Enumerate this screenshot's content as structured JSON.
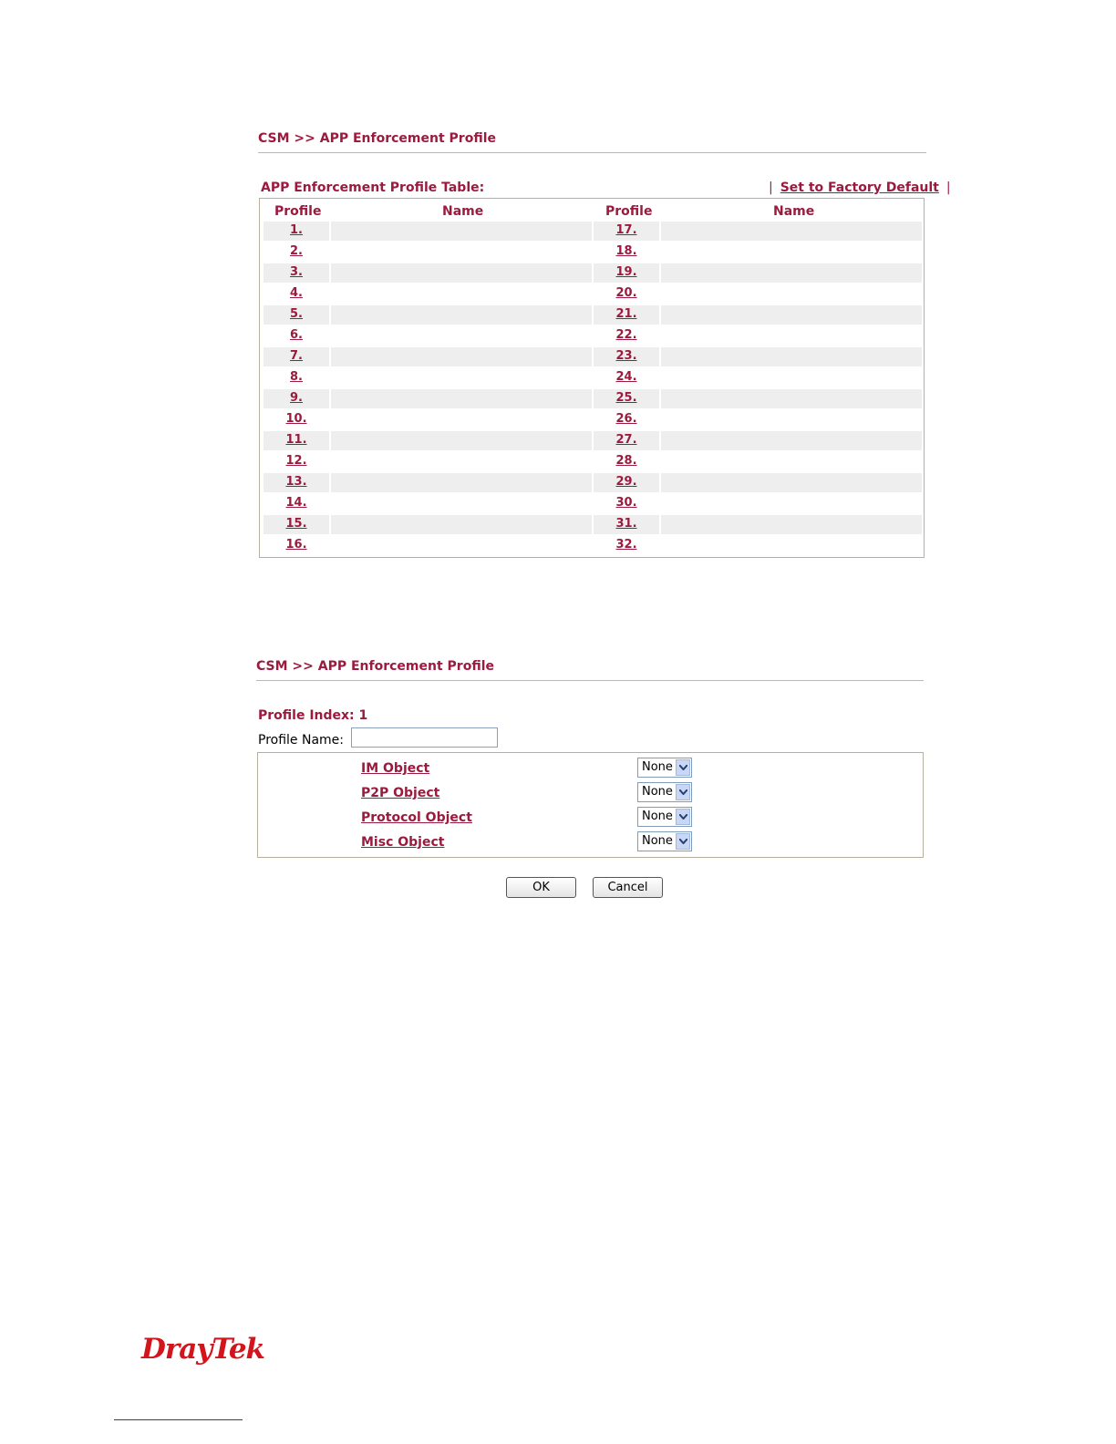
{
  "panel1": {
    "breadcrumb": "CSM >> APP Enforcement Profile",
    "table_title": "APP Enforcement Profile Table:",
    "separator": "|",
    "factory_default": "Set to Factory Default",
    "columns": {
      "profile": "Profile",
      "name": "Name"
    },
    "left_profiles": [
      "1.",
      "2.",
      "3.",
      "4.",
      "5.",
      "6.",
      "7.",
      "8.",
      "9.",
      "10.",
      "11.",
      "12.",
      "13.",
      "14.",
      "15.",
      "16."
    ],
    "right_profiles": [
      "17.",
      "18.",
      "19.",
      "20.",
      "21.",
      "22.",
      "23.",
      "24.",
      "25.",
      "26.",
      "27.",
      "28.",
      "29.",
      "30.",
      "31.",
      "32."
    ]
  },
  "panel2": {
    "breadcrumb": "CSM >> APP Enforcement Profile",
    "profile_index": "Profile Index: 1",
    "profile_name_label": "Profile Name:",
    "profile_name_value": "",
    "objects": [
      {
        "label": "IM Object",
        "value": "None"
      },
      {
        "label": "P2P Object",
        "value": "None"
      },
      {
        "label": "Protocol Object",
        "value": "None"
      },
      {
        "label": "Misc Object",
        "value": "None"
      }
    ],
    "ok_label": "OK",
    "cancel_label": "Cancel"
  },
  "logo": "DrayTek",
  "colors": {
    "accent": "#9b1b3f",
    "row_shade": "#eeeeee",
    "logo": "#d4141c"
  }
}
